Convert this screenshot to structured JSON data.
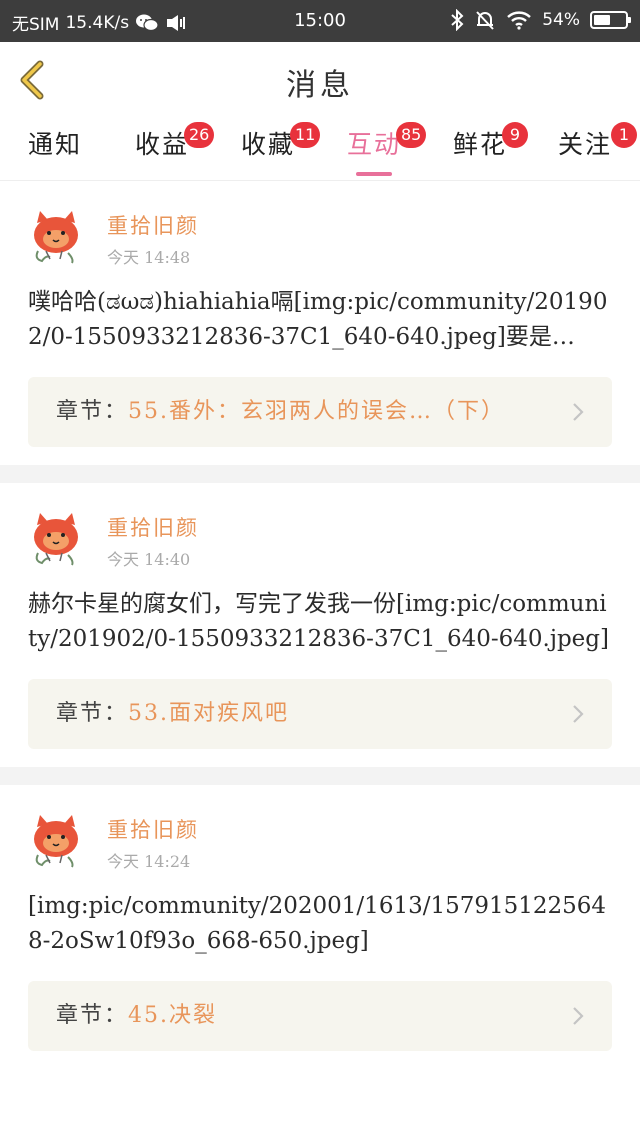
{
  "status_bar": {
    "carrier": "无SIM",
    "speed": "15.4K/s",
    "time": "15:00",
    "battery": "54%",
    "battery_level": 0.54,
    "icons": [
      "wechat-icon",
      "speaker-icon",
      "bluetooth-icon",
      "mute-bell-icon",
      "wifi-icon",
      "battery-icon"
    ]
  },
  "header": {
    "title": "消息",
    "back_icon": "chevron-left-icon"
  },
  "tabs": [
    {
      "label": "通知",
      "badge": null,
      "active": false
    },
    {
      "label": "收益",
      "badge": "26",
      "active": false
    },
    {
      "label": "收藏",
      "badge": "11",
      "active": false
    },
    {
      "label": "互动",
      "badge": "85",
      "active": true
    },
    {
      "label": "鲜花",
      "badge": "9",
      "active": false
    },
    {
      "label": "关注",
      "badge": "1",
      "active": false
    }
  ],
  "colors": {
    "accent_pink": "#e8709a",
    "badge_red": "#e8323c",
    "username_orange": "#e8955a",
    "chapter_bg": "#f6f5ee"
  },
  "messages": [
    {
      "username": "重拾旧颜",
      "time": "今天 14:48",
      "content": "噗哈哈(ಡωಡ)hiahiahia嗝[img:pic/community/201902/0-1550933212836-37C1_640-640.jpeg]要是…",
      "chapter_prefix": "章节：",
      "chapter_title": "55.番外：玄羽两人的误会…（下）"
    },
    {
      "username": "重拾旧颜",
      "time": "今天 14:40",
      "content": "赫尔卡星的腐女们，写完了发我一份[img:pic/community/201902/0-1550933212836-37C1_640-640.jpeg]",
      "chapter_prefix": "章节：",
      "chapter_title": "53.面对疾风吧"
    },
    {
      "username": "重拾旧颜",
      "time": "今天 14:24",
      "content": "[img:pic/community/202001/1613/1579151225648-2oSw10f93o_668-650.jpeg]",
      "chapter_prefix": "章节：",
      "chapter_title": "45.决裂"
    }
  ]
}
